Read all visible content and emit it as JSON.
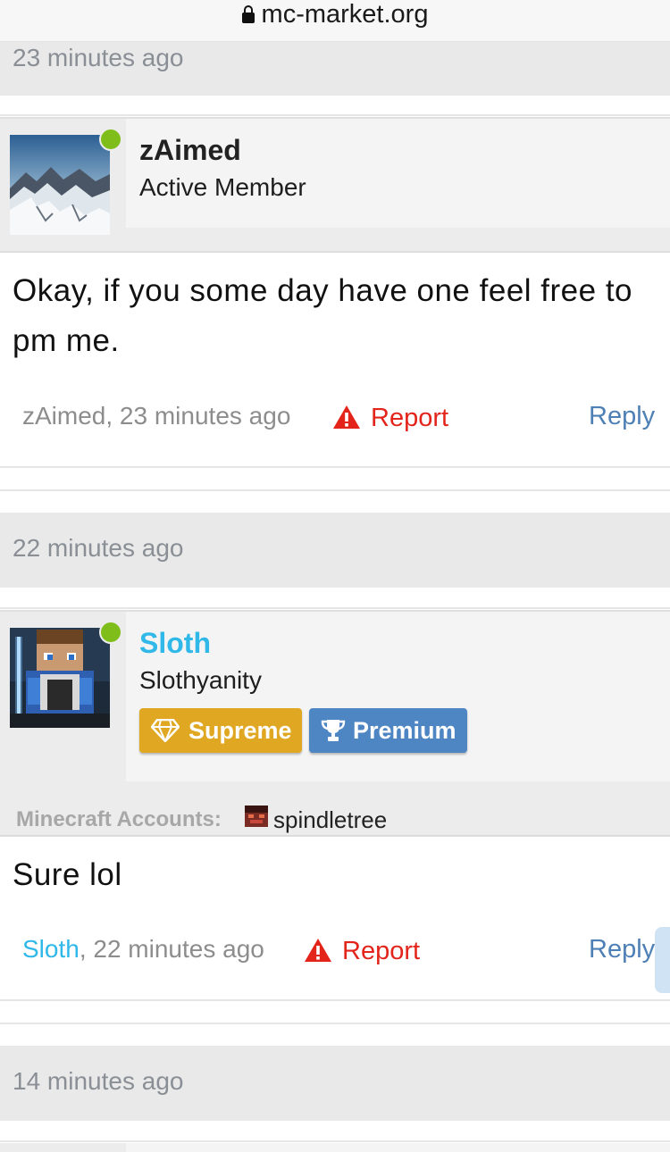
{
  "browser": {
    "url": "mc-market.org"
  },
  "posts": [
    {
      "date_band": "23 minutes ago",
      "username": "zAimed",
      "username_color": "#222222",
      "user_title": "Active Member",
      "online": true,
      "message": "Okay, if you some day have one feel free to pm me.",
      "meta_user": "zAimed",
      "meta_time": ", 23 minutes ago",
      "report_label": "Report",
      "reply_label": "Reply"
    },
    {
      "date_band": "22 minutes ago",
      "username": "Sloth",
      "username_color": "#2fb8e8",
      "user_title": "Slothyanity",
      "online": true,
      "badges": [
        {
          "label": "Supreme",
          "icon": "diamond-icon",
          "color": "#e0a822"
        },
        {
          "label": "Premium",
          "icon": "trophy-icon",
          "color": "#4e86c4"
        }
      ],
      "minecraft_accounts_label": "Minecraft Accounts:",
      "minecraft_account": "spindletree",
      "message": "Sure lol",
      "meta_user": "Sloth",
      "meta_time": ", 22 minutes ago",
      "report_label": "Report",
      "reply_label": "Reply"
    }
  ],
  "next_date_band": "14 minutes ago"
}
